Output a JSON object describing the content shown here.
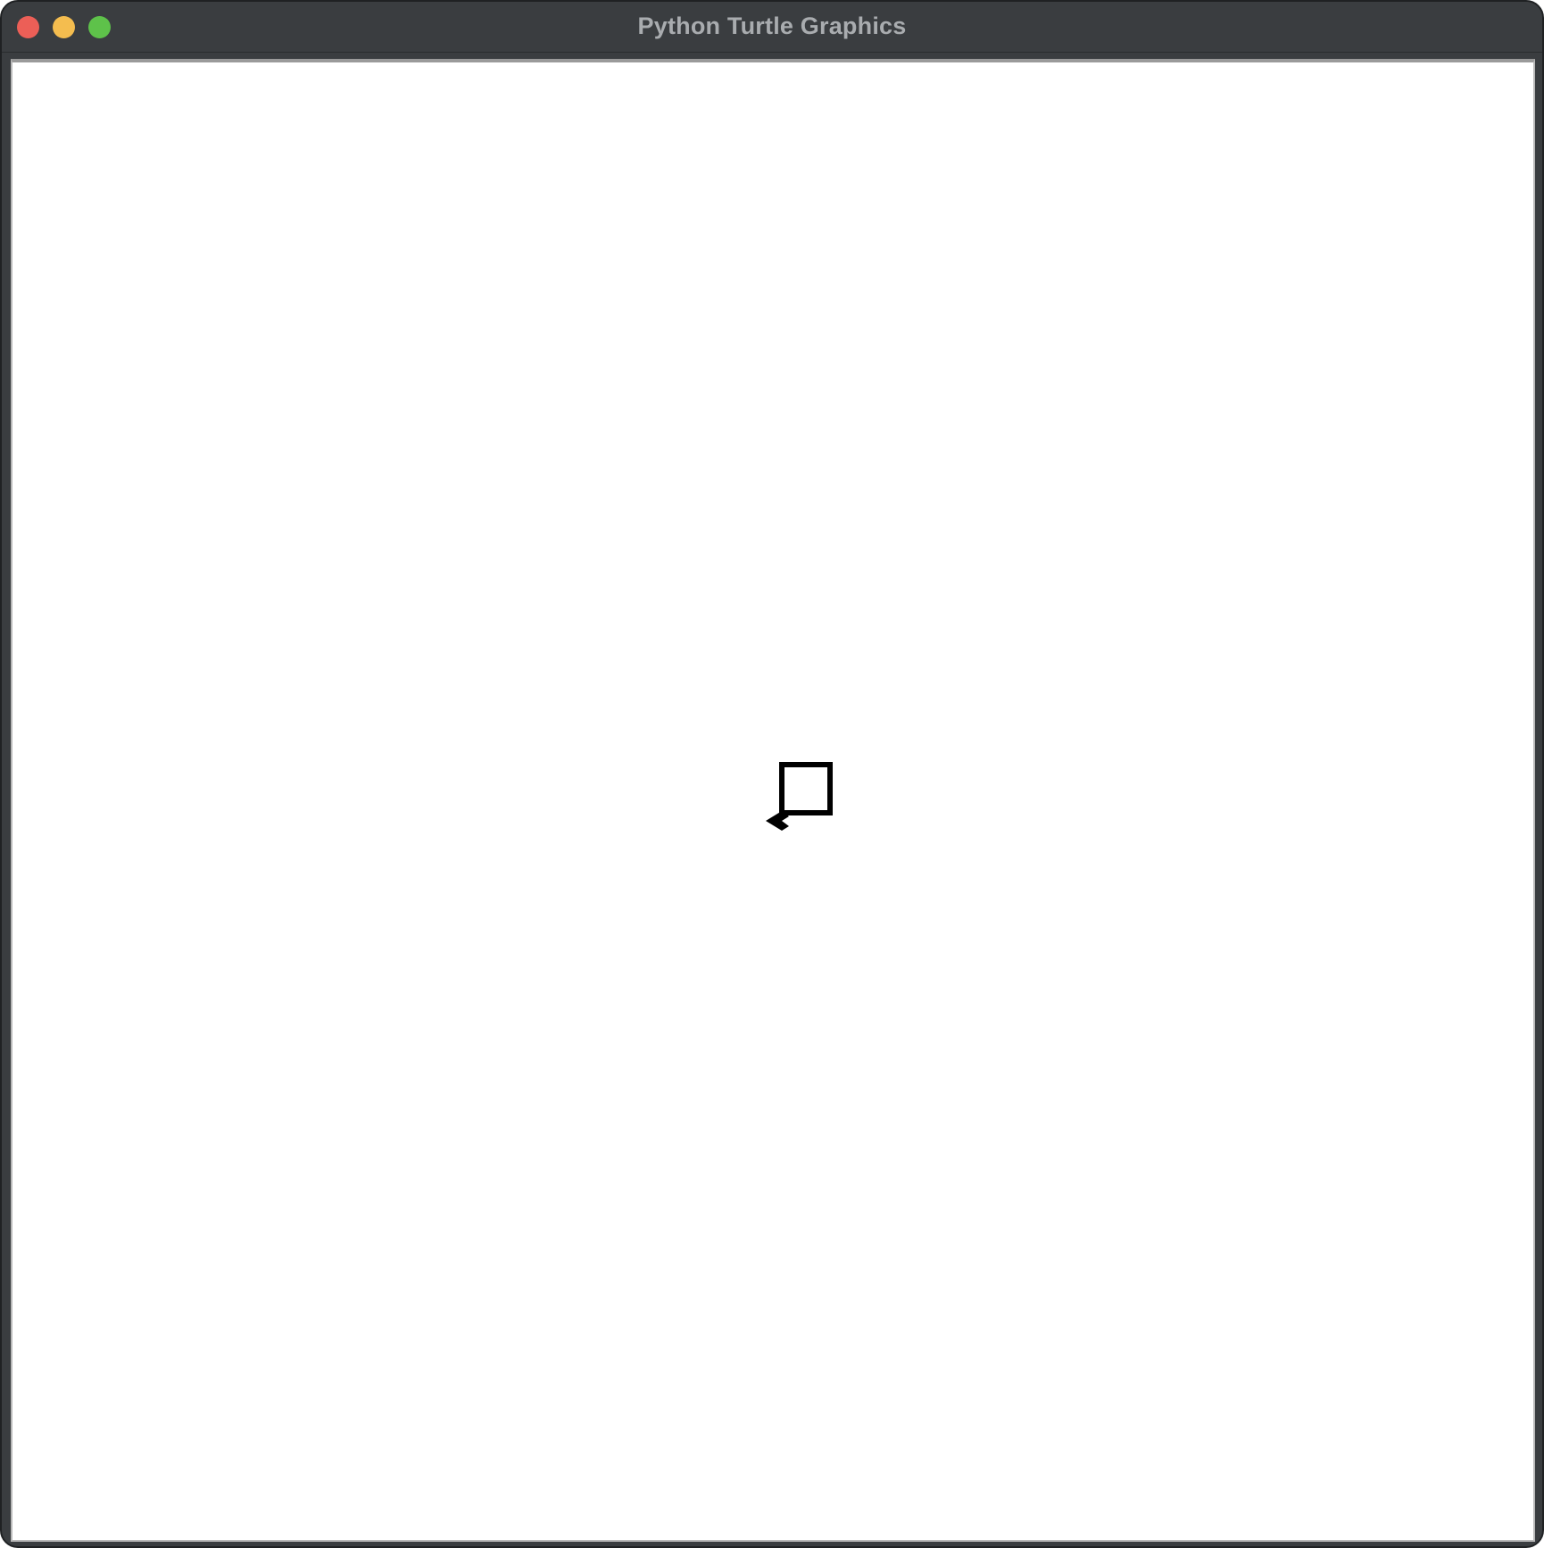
{
  "window": {
    "title": "Python Turtle Graphics",
    "controls": [
      {
        "name": "close",
        "color": "#ec5f57"
      },
      {
        "name": "minimize",
        "color": "#f4bd4f"
      },
      {
        "name": "zoom",
        "color": "#5ec24a"
      }
    ]
  },
  "canvas": {
    "background": "#ffffff",
    "pen_color": "#000000",
    "turtle_shape": "arrow-classic",
    "turtle_heading": "left"
  }
}
